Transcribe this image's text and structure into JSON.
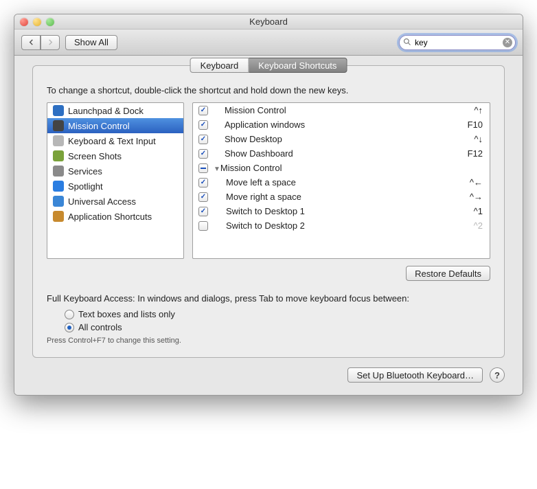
{
  "window": {
    "title": "Keyboard"
  },
  "toolbar": {
    "show_all_label": "Show All",
    "search_value": "key"
  },
  "tabs": [
    "Keyboard",
    "Keyboard Shortcuts"
  ],
  "active_tab": 1,
  "description": "To change a shortcut, double-click the shortcut and hold down the new keys.",
  "categories": [
    {
      "label": "Launchpad & Dock",
      "icon_color": "#2d6fc2",
      "selected": false
    },
    {
      "label": "Mission Control",
      "icon_color": "#444",
      "selected": true
    },
    {
      "label": "Keyboard & Text Input",
      "icon_color": "#b7b7b7",
      "selected": false
    },
    {
      "label": "Screen Shots",
      "icon_color": "#7aa23a",
      "selected": false
    },
    {
      "label": "Services",
      "icon_color": "#8a8a8a",
      "selected": false
    },
    {
      "label": "Spotlight",
      "icon_color": "#2a7de1",
      "selected": false
    },
    {
      "label": "Universal Access",
      "icon_color": "#3a86d6",
      "selected": false
    },
    {
      "label": "Application Shortcuts",
      "icon_color": "#c78a2e",
      "selected": false
    }
  ],
  "shortcuts": [
    {
      "name": "Mission Control",
      "key": "^↑",
      "checked": "on",
      "indent": 0,
      "header": false
    },
    {
      "name": "Application windows",
      "key": "F10",
      "checked": "on",
      "indent": 0,
      "header": false
    },
    {
      "name": "Show Desktop",
      "key": "^↓",
      "checked": "on",
      "indent": 0,
      "header": false
    },
    {
      "name": "Show Dashboard",
      "key": "F12",
      "checked": "on",
      "indent": 0,
      "header": false
    },
    {
      "name": "Mission Control",
      "key": "",
      "checked": "mixed",
      "indent": 0,
      "header": true
    },
    {
      "name": "Move left a space",
      "key": "^←",
      "checked": "on",
      "indent": 1,
      "header": false
    },
    {
      "name": "Move right a space",
      "key": "^→",
      "checked": "on",
      "indent": 1,
      "header": false
    },
    {
      "name": "Switch to Desktop 1",
      "key": "^1",
      "checked": "on",
      "indent": 1,
      "header": false
    },
    {
      "name": "Switch to Desktop 2",
      "key": "^2",
      "checked": "off",
      "indent": 1,
      "header": false,
      "disabled": true
    }
  ],
  "restore_label": "Restore Defaults",
  "fka": {
    "prompt": "Full Keyboard Access: In windows and dialogs, press Tab to move keyboard focus between:",
    "options": [
      "Text boxes and lists only",
      "All controls"
    ],
    "selected": 1,
    "hint": "Press Control+F7 to change this setting."
  },
  "bluetooth_label": "Set Up Bluetooth Keyboard…",
  "help_label": "?"
}
